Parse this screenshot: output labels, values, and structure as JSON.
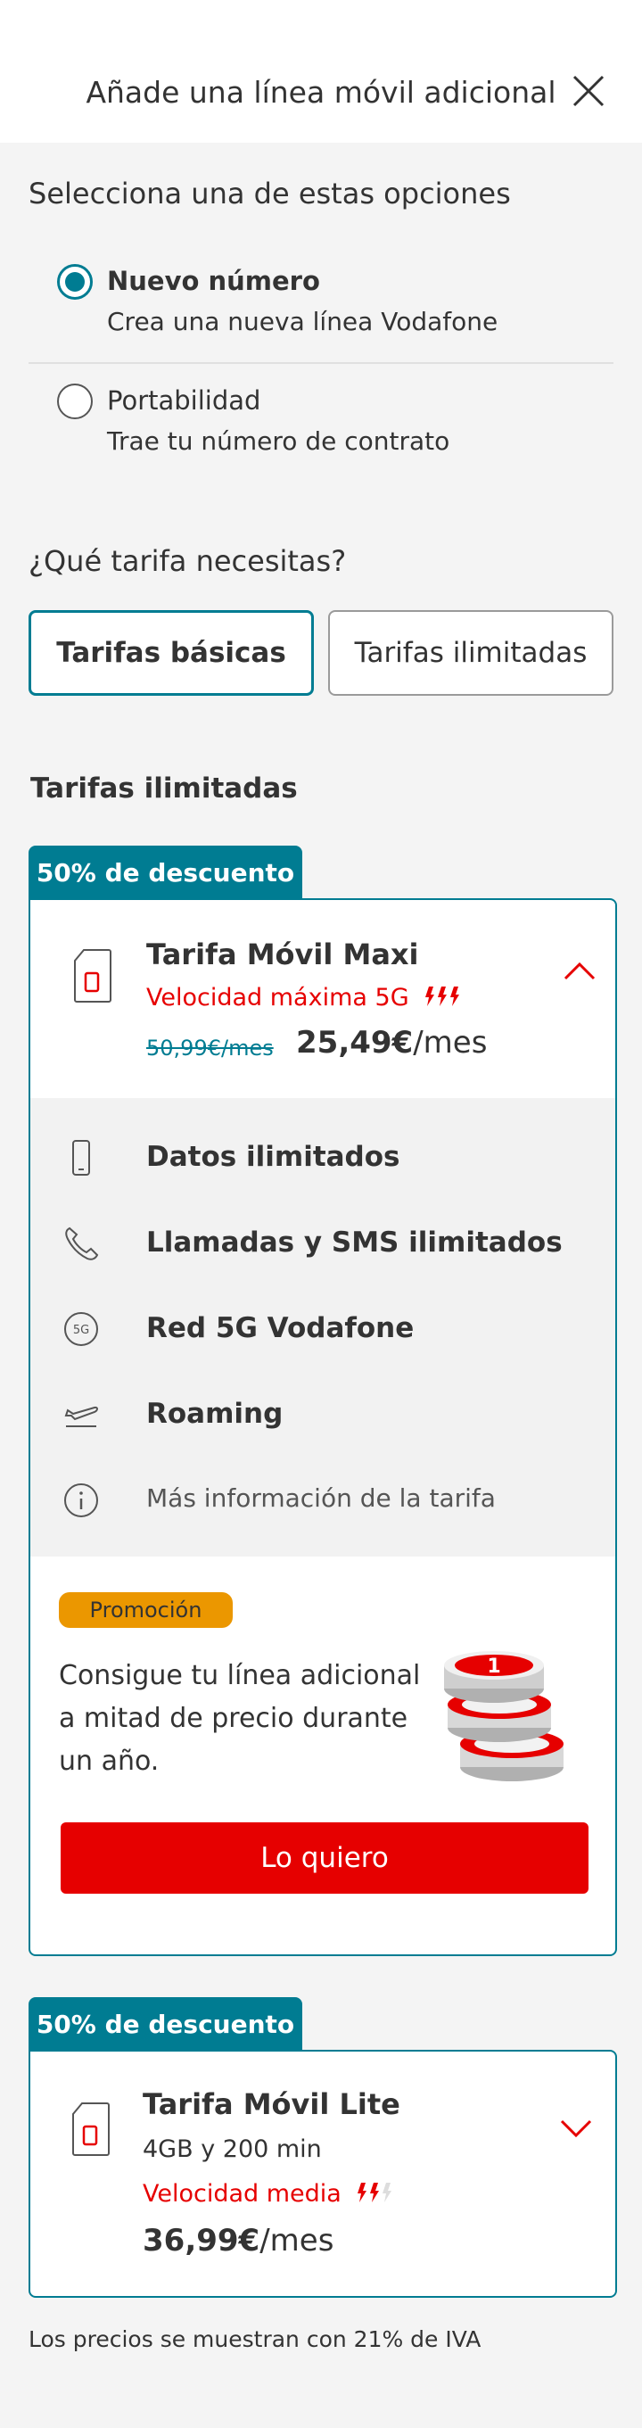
{
  "header": {
    "title": "Añade una línea móvil adicional",
    "close_icon": "close-icon"
  },
  "options": {
    "label": "Selecciona una de estas opciones",
    "items": [
      {
        "title": "Nuevo número",
        "subtitle": "Crea una nueva línea Vodafone",
        "selected": true
      },
      {
        "title": "Portabilidad",
        "subtitle": "Trae tu número de contrato",
        "selected": false
      }
    ]
  },
  "tariff_type": {
    "label": "¿Qué tarifa necesitas?",
    "tabs": [
      {
        "label": "Tarifas básicas",
        "active": true
      },
      {
        "label": "Tarifas ilimitadas",
        "active": false
      }
    ]
  },
  "list": {
    "heading": "Tarifas ilimitadas",
    "plans": [
      {
        "badge": "50% de descuento",
        "name": "Tarifa Móvil Maxi",
        "speed": "Velocidad máxima 5G",
        "old_price": "50,99€/mes",
        "price": "25,49€",
        "per": "/mes",
        "expanded": true,
        "features": [
          {
            "icon": "phone-icon",
            "text": "Datos ilimitados"
          },
          {
            "icon": "call-icon",
            "text": "Llamadas y SMS ilimitados"
          },
          {
            "icon": "5g-icon",
            "text": "Red 5G Vodafone"
          },
          {
            "icon": "plane-icon",
            "text": "Roaming"
          },
          {
            "icon": "info-icon",
            "text": "Más información de la tarifa"
          }
        ],
        "promo": {
          "pill": "Promoción",
          "text": "Consigue tu línea adicional a mitad de precio durante un año.",
          "cta": "Lo quiero"
        }
      },
      {
        "badge": "50% de descuento",
        "name": "Tarifa Móvil Lite",
        "data": "4GB y 200 min",
        "speed": "Velocidad media",
        "price": "36,99€",
        "per": "/mes",
        "expanded": false
      }
    ]
  },
  "footnote": "Los precios se muestran con 21% de IVA",
  "colors": {
    "accent": "#007c92",
    "brand_red": "#e60000",
    "promo": "#eb9700"
  }
}
